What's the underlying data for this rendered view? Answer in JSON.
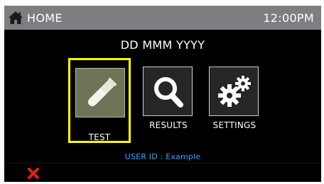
{
  "header": {
    "home_label": "HOME",
    "time": "12:00PM",
    "home_icon": "home-icon"
  },
  "date": "DD MMM YYYY",
  "menu": {
    "test": {
      "label": "TEST",
      "icon": "test-tube-icon",
      "selected": true
    },
    "results": {
      "label": "RESULTS",
      "icon": "search-icon"
    },
    "settings": {
      "label": "SETTINGS",
      "icon": "gears-icon"
    }
  },
  "user_id": "USER ID : Example",
  "footer": {
    "cancel_icon": "close-icon"
  },
  "colors": {
    "highlight": "#ffff00",
    "status_bar": "#7e7e80",
    "user_id": "#3aa3ff",
    "cancel": "#e0201c"
  }
}
